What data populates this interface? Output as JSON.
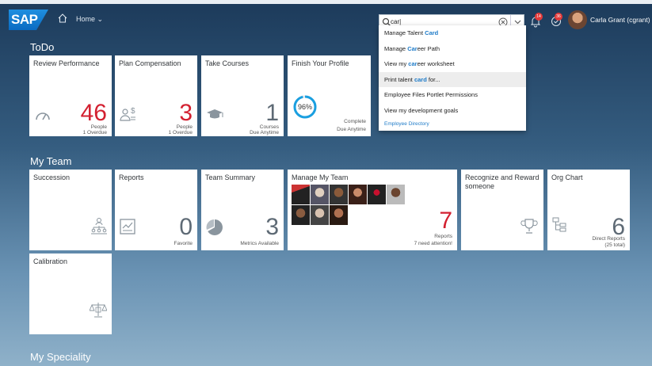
{
  "shell": {
    "logo": "SAP",
    "home_label": "Home ⌄",
    "search_value": "car|",
    "badge1": "14",
    "badge2": "36",
    "user_name": "Carla Grant (cgrant)"
  },
  "dropdown": {
    "items": [
      {
        "pre": "Manage Talent ",
        "hl": "Card",
        "post": ""
      },
      {
        "pre": "Manage ",
        "hl": "Car",
        "post": "eer Path"
      },
      {
        "pre": "View my ",
        "hl": "car",
        "post": "eer worksheet"
      },
      {
        "pre": "Print talent ",
        "hl": "card",
        "post": " for..."
      },
      {
        "pre": "Employee Files Portlet Permissions",
        "hl": "",
        "post": ""
      },
      {
        "pre": "View my development goals",
        "hl": "",
        "post": ""
      }
    ],
    "footer": "Employee Directory"
  },
  "sections": {
    "todo": "ToDo",
    "team": "My Team",
    "speciality": "My Speciality"
  },
  "todo_tiles": {
    "review": {
      "title": "Review Performance",
      "value": "46",
      "sub1": "People",
      "sub2": "1 Overdue"
    },
    "plan": {
      "title": "Plan Compensation",
      "value": "3",
      "sub1": "People",
      "sub2": "1 Overdue"
    },
    "courses": {
      "title": "Take Courses",
      "value": "1",
      "sub1": "Courses",
      "sub2": "Due Anytime"
    },
    "profile": {
      "title": "Finish Your Profile",
      "percent": "96%",
      "progress": 0.96,
      "sub1": "Complete",
      "sub2": "Due Anytime"
    }
  },
  "team_tiles": {
    "succession": {
      "title": "Succession"
    },
    "reports": {
      "title": "Reports",
      "value": "0",
      "sub1": "Favorite"
    },
    "summary": {
      "title": "Team Summary",
      "value": "3",
      "sub1": "Metrics Available"
    },
    "manage": {
      "title": "Manage My Team",
      "value": "7",
      "sub1": "Reports",
      "sub2": "7 need attention!"
    },
    "recognize": {
      "title": "Recognize and Reward someone"
    },
    "org": {
      "title": "Org Chart",
      "value": "6",
      "sub1": "Direct Reports",
      "sub2": "(25 total)"
    },
    "calibration": {
      "title": "Calibration"
    }
  },
  "colors": {
    "accent": "#1e7bc8",
    "alert": "#d32030",
    "progress": "#1a9fe0"
  }
}
